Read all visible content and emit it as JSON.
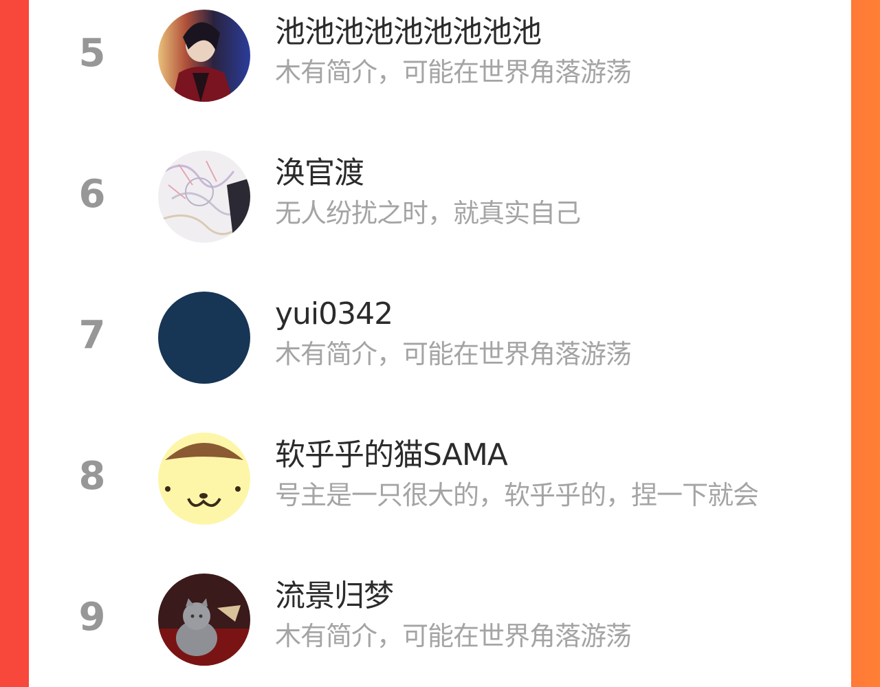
{
  "ranking": [
    {
      "rank": "5",
      "name": "池池池池池池池池池",
      "bio": "木有简介，可能在世界角落游荡",
      "avatar_icon": "anime-character-avatar"
    },
    {
      "rank": "6",
      "name": "涣官渡",
      "bio": "无人纷扰之时，就真实自己",
      "avatar_icon": "sketch-illustration-avatar"
    },
    {
      "rank": "7",
      "name": "yui0342",
      "bio": "木有简介，可能在世界角落游荡",
      "avatar_icon": "solid-navy-avatar"
    },
    {
      "rank": "8",
      "name": "软乎乎的猫SAMA",
      "bio": "号主是一只很大的，软乎乎的，捏一下就会",
      "avatar_icon": "pompompurin-avatar"
    },
    {
      "rank": "9",
      "name": "流景归梦",
      "bio": "木有简介，可能在世界角落游荡",
      "avatar_icon": "grey-cat-avatar"
    }
  ],
  "colors": {
    "background_left": "#f8473b",
    "background_right": "#ff7f35",
    "panel": "#ffffff",
    "rank_text": "#979797",
    "name_text": "#2b2b2b",
    "bio_text": "#a4a4a4",
    "navy_avatar": "#173555",
    "purin_yellow": "#fdf6a8"
  }
}
